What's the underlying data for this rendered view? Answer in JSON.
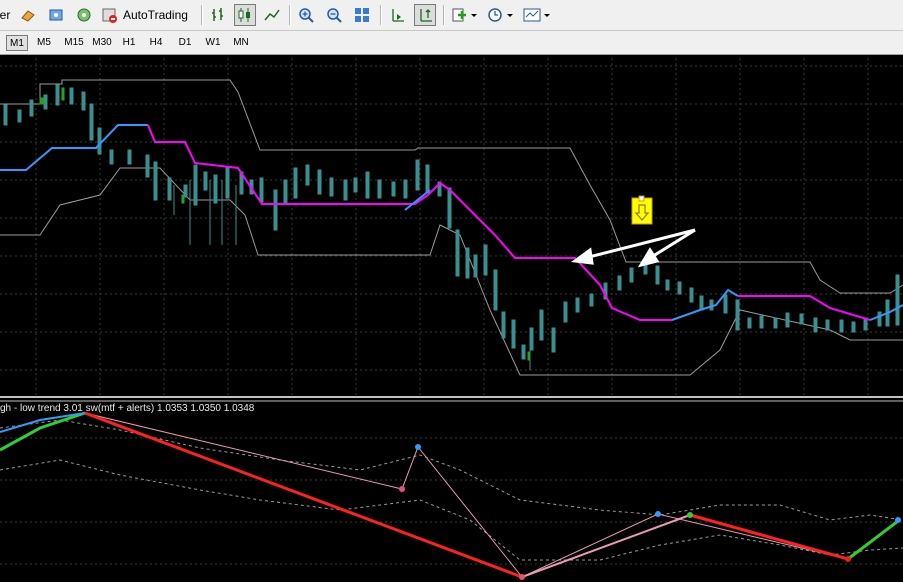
{
  "toolbar": {
    "partial_label": "er",
    "autotrading_label": "AutoTrading",
    "icons": [
      "expert-icon",
      "navigator-icon",
      "market-watch-icon",
      "signal-icon",
      "autotrading-icon",
      "bar-chart-icon",
      "candlestick-icon",
      "line-chart-icon",
      "zoom-in-icon",
      "zoom-out-icon",
      "tile-icon",
      "scroll-icon",
      "shift-icon",
      "indicators-icon",
      "periods-icon",
      "templates-icon"
    ]
  },
  "timeframes": [
    "M1",
    "M5",
    "M15",
    "M30",
    "H1",
    "H4",
    "D1",
    "W1",
    "MN"
  ],
  "active_timeframe": "M1",
  "indicator_label": "gh - low trend 3.01 sw(mtf + alerts) 1.0353 1.0350 1.0348",
  "colors": {
    "background": "#000000",
    "grid": "#2a2a2a",
    "bull_candle": "#3a8a8a",
    "baseline_up": "#3399ff",
    "baseline_down": "#ff00ff",
    "channel": "#b0b0b0",
    "zigzag_down": "#ff2020",
    "zigzag_up": "#33cc33",
    "signal_arrow_bg": "#ffff00",
    "annotation_arrow": "#ffffff"
  }
}
